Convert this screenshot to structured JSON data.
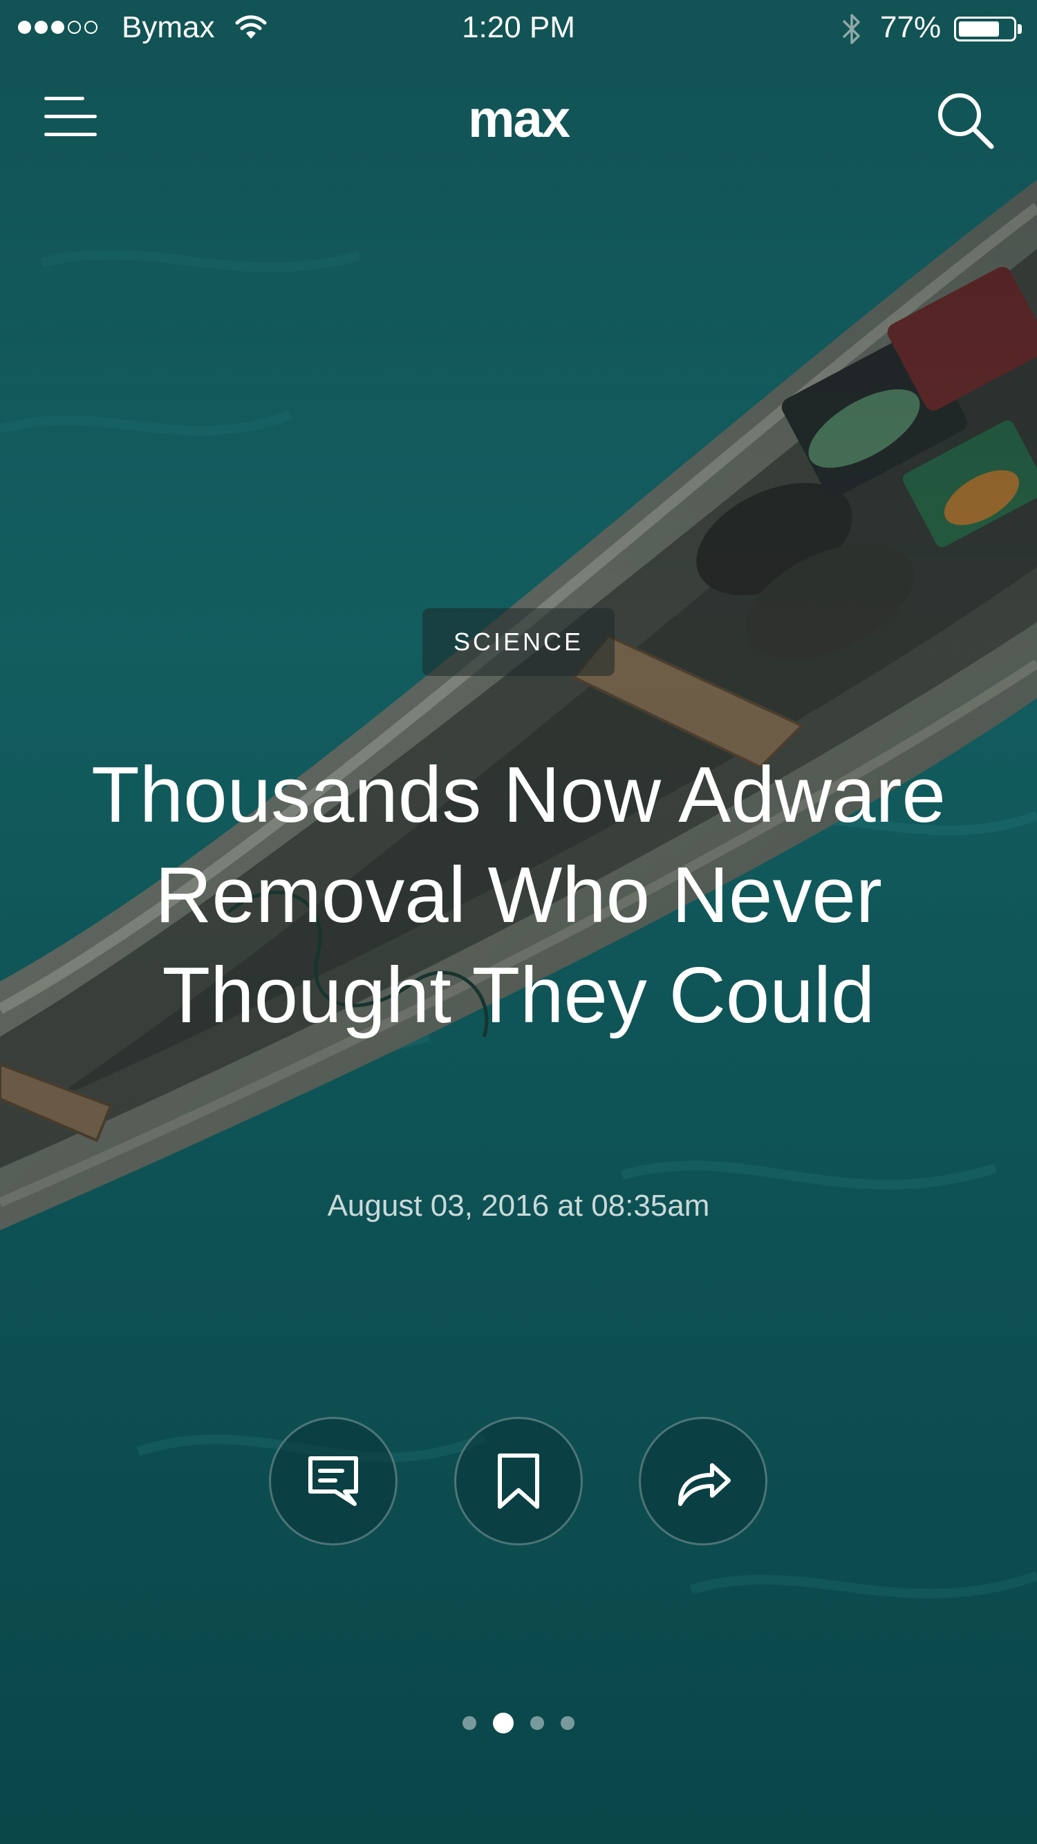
{
  "status_bar": {
    "carrier": "Bymax",
    "time": "1:20 PM",
    "battery_percent": "77%",
    "battery_level": 0.77,
    "signal_bars_filled": 3,
    "signal_bars_total": 5
  },
  "nav": {
    "logo": "max",
    "menu_icon": "hamburger-menu-icon",
    "search_icon": "search-icon"
  },
  "article": {
    "category": "SCIENCE",
    "headline": "Thousands Now Adware Removal Who Never Thought They Could",
    "date": "August 03, 2016 at 08:35am"
  },
  "actions": [
    {
      "icon": "comment-icon"
    },
    {
      "icon": "bookmark-icon"
    },
    {
      "icon": "share-icon"
    }
  ],
  "pager": {
    "total": 4,
    "active_index": 1
  },
  "colors": {
    "background_water": "#0f5f63",
    "text": "#ffffff",
    "category_bg": "#1e2828"
  }
}
